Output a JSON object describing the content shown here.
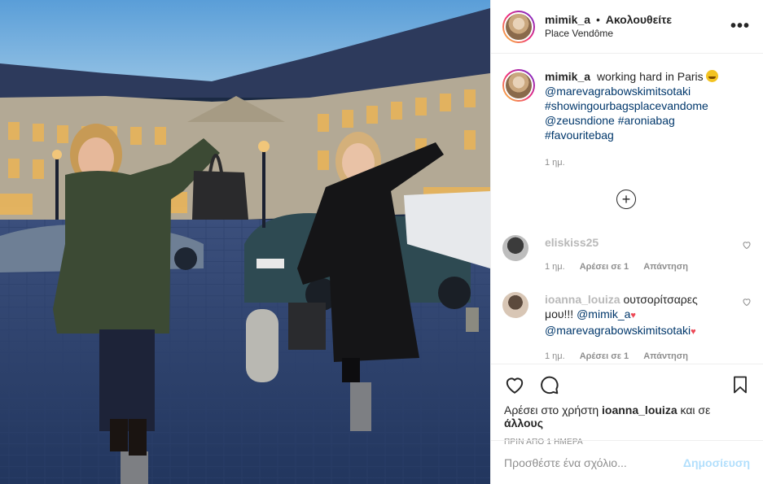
{
  "header": {
    "username": "mimik_a",
    "separator": "•",
    "follow_label": "Ακολουθείτε",
    "location": "Place Vendôme",
    "more_label": "•••"
  },
  "caption": {
    "username": "mimik_a",
    "text": "working hard in Paris",
    "mention1": "@marevagrabowskimitsotaki",
    "hashtag1": "#showingourbagsplacevandome",
    "mention2": "@zeusndione",
    "hashtag2": "#aroniabag",
    "hashtag3": "#favouritebag",
    "time": "1 ημ."
  },
  "comments": [
    {
      "username": "eliskiss25",
      "text": "",
      "time": "1 ημ.",
      "likes_label": "Αρέσει σε 1",
      "reply_label": "Απάντηση"
    },
    {
      "username": "ioanna_louiza",
      "text": "ουτσορίτσαρες μου!!!",
      "mention1": "@mimik_a",
      "mention2": "@marevagrabowskimitsotaki",
      "time": "1 ημ.",
      "likes_label": "Αρέσει σε 1",
      "reply_label": "Απάντηση"
    }
  ],
  "actions": {
    "likes_prefix": "Αρέσει στο χρήστη",
    "likes_user": "ioanna_louiza",
    "likes_suffix": "και σε",
    "likes_others": "άλλους",
    "time_ago": "ΠΡΙΝ ΑΠΟ 1 ΗΜΕΡΑ"
  },
  "add_comment": {
    "placeholder": "Προσθέστε ένα σχόλιο...",
    "post_label": "Δημοσίευση"
  },
  "icons": [
    "heart-icon",
    "comment-icon",
    "bookmark-icon",
    "plus-circle-icon",
    "more-icon"
  ]
}
